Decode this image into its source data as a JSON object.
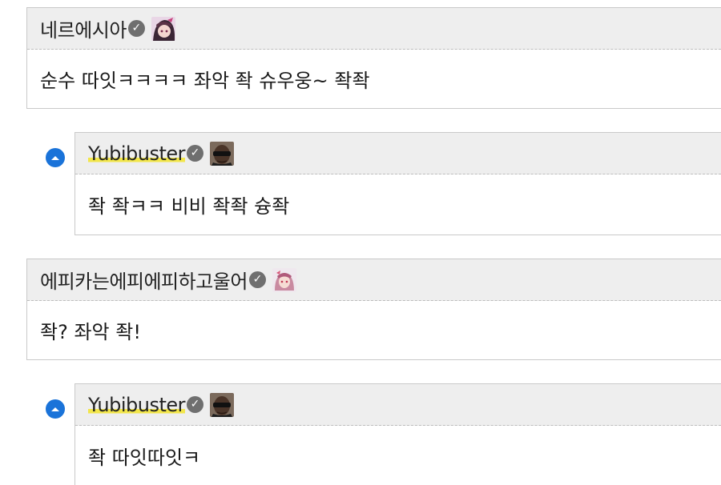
{
  "comments": [
    {
      "author": "네르에시아",
      "text": "순수 따잇ㅋㅋㅋㅋ 좌악 좍 슈우웅~ 좍좍",
      "verified_icon": "check-circle-icon",
      "avatar": "pink-anime-avatar"
    },
    {
      "author": "Yubibuster",
      "text": "좍 좍ㅋㅋ 비비 좍좍 슝좍",
      "verified_icon": "check-circle-icon",
      "avatar": "sunglasses-man-avatar",
      "is_reply": true
    },
    {
      "author": "에피카는에피에피하고울어",
      "text": "좍? 좌악 좍!",
      "verified_icon": "check-circle-icon",
      "avatar": "anime-girl-avatar"
    },
    {
      "author": "Yubibuster",
      "text": "좍 따잇따잇ㅋ",
      "verified_icon": "check-circle-icon",
      "avatar": "sunglasses-man-avatar",
      "is_reply": true
    }
  ],
  "colors": {
    "header_bg": "#eeeeee",
    "border": "#c9c9c9",
    "highlight": "#f2e64a",
    "reply_arrow": "#1a73d9"
  },
  "check_glyph": "✓"
}
